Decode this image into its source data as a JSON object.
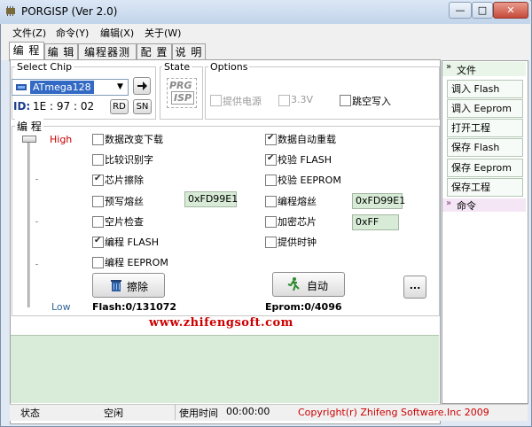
{
  "window": {
    "title": "PORGISP (Ver 2.0)",
    "minimize": "—",
    "maximize": "□",
    "close": "✕"
  },
  "menu": [
    "文件(Z)",
    "命令(Y)",
    "编辑(X)",
    "关于(W)"
  ],
  "tabs": [
    "编 程",
    "编 辑",
    "编程器测试",
    "配 置",
    "说 明"
  ],
  "select_chip": {
    "label": "Select Chip",
    "value": "ATmega128",
    "id_label": "ID:",
    "id_value": "1E : 97 : 02",
    "rd": "RD",
    "sn": "SN"
  },
  "state": {
    "label": "State",
    "logo_line1": "PRG",
    "logo_line2": "ISP"
  },
  "options": {
    "label": "Options",
    "items": [
      {
        "label": "提供电源",
        "checked": false,
        "disabled": true
      },
      {
        "label": "3.3V",
        "checked": false,
        "disabled": true
      },
      {
        "label": "跳空写入",
        "checked": false,
        "disabled": false
      }
    ]
  },
  "prog": {
    "label": "编 程",
    "high": "High",
    "low": "Low",
    "left": [
      {
        "label": "数据改变下载",
        "checked": false
      },
      {
        "label": "比较识别字",
        "checked": false
      },
      {
        "label": "芯片擦除",
        "checked": true
      },
      {
        "label": "预写熔丝",
        "checked": false
      },
      {
        "label": "空片检查",
        "checked": false
      },
      {
        "label": "编程 FLASH",
        "checked": true
      },
      {
        "label": "编程 EEPROM",
        "checked": false
      }
    ],
    "right": [
      {
        "label": "数据自动重载",
        "checked": true
      },
      {
        "label": "校验 FLASH",
        "checked": true
      },
      {
        "label": "校验 EEPROM",
        "checked": false
      },
      {
        "label": "编程熔丝",
        "checked": false
      },
      {
        "label": "加密芯片",
        "checked": false
      },
      {
        "label": "提供时钟",
        "checked": false
      }
    ],
    "fuse_left": "0xFD99E1",
    "fuse_right": "0xFD99E1",
    "lock": "0xFF",
    "erase_btn": "擦除",
    "auto_btn": "自动",
    "more_btn": "...",
    "flash": "Flash:0/131072",
    "eprom": "Eprom:0/4096",
    "website": "www.zhifengsoft.com"
  },
  "sidebar": {
    "file_header": "文件",
    "buttons": [
      "调入 Flash",
      "调入 Eeprom",
      "打开工程",
      "保存 Flash",
      "保存 Eeprom",
      "保存工程"
    ],
    "cmd_header": "命令"
  },
  "status": {
    "state_label": "状态",
    "state_value": "空闲",
    "time_label": "使用时间",
    "time_value": "00:00:00",
    "copyright": "Copyright(r) Zhifeng Software.Inc 2009"
  },
  "colors": {
    "website": "#cc0000",
    "copyright": "#cc0000",
    "high": "#cc0000",
    "low": "#336699",
    "hex_bg": "#d7ebd7",
    "log_bg": "#d9ecd9"
  }
}
